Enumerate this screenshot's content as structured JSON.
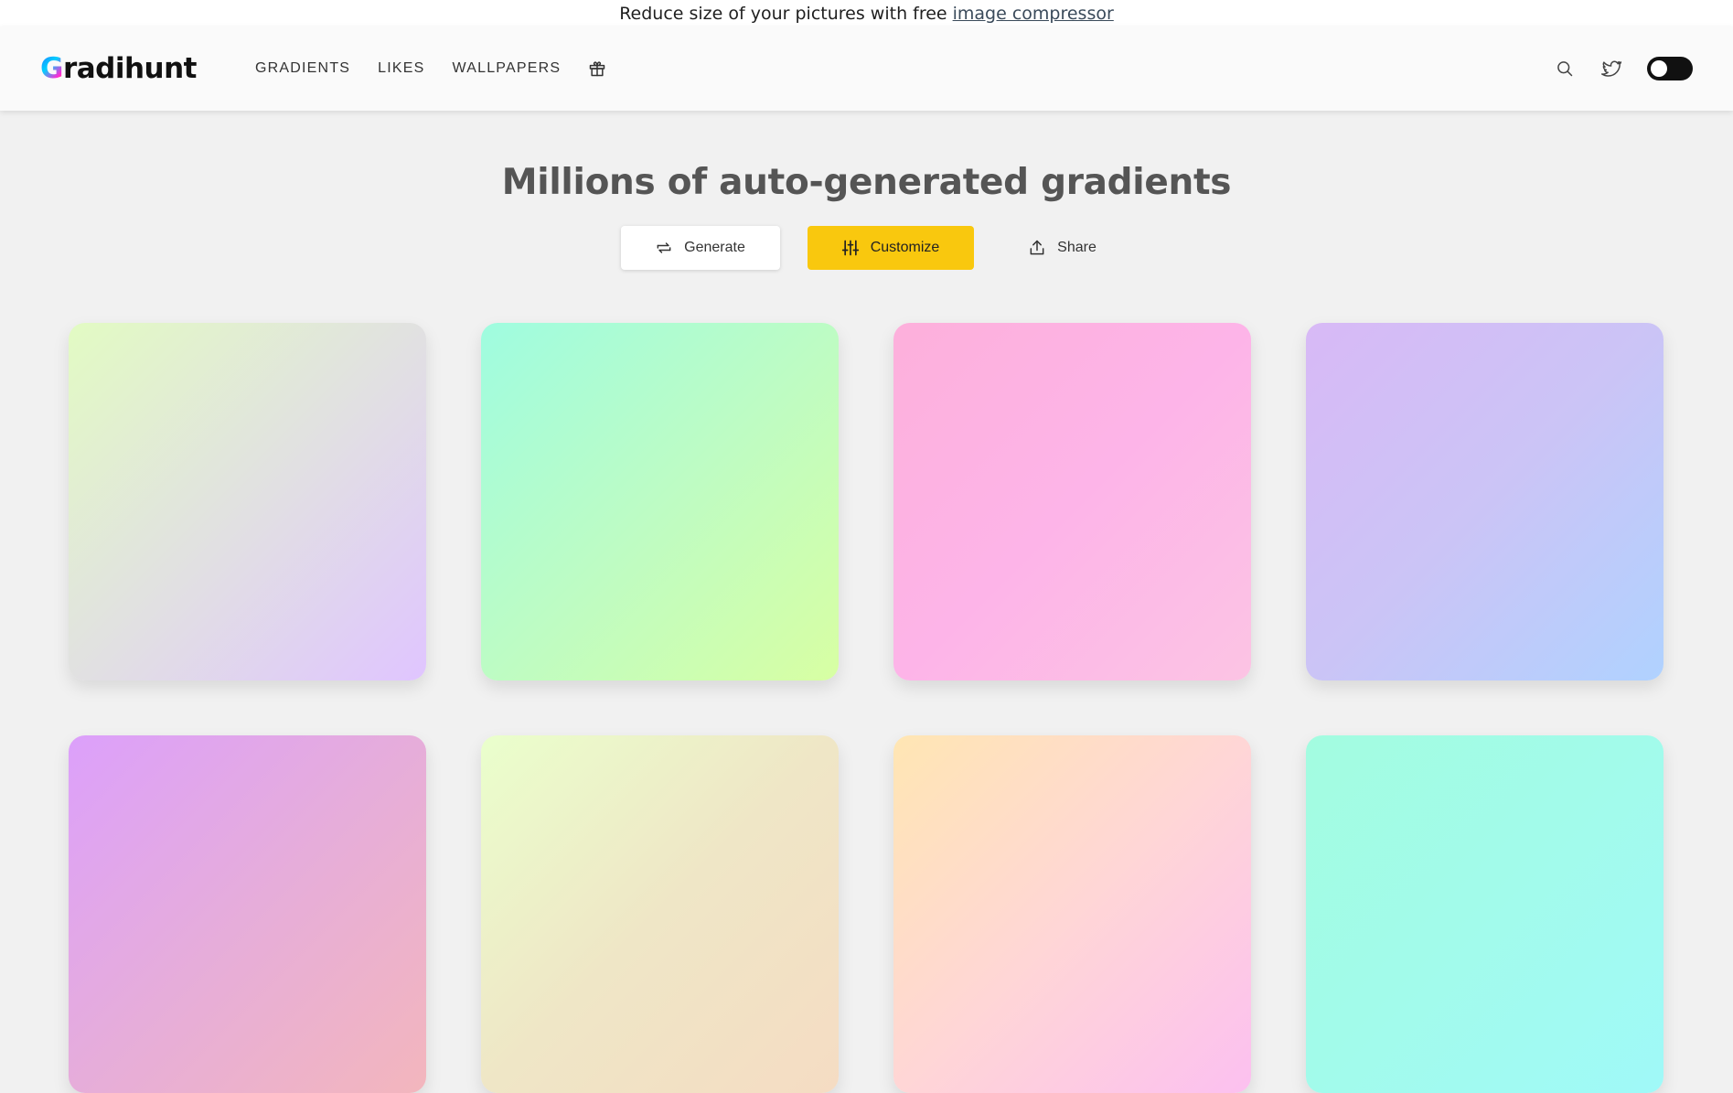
{
  "promo": {
    "text": "Reduce size of your pictures with free",
    "link_text": "image compressor"
  },
  "header": {
    "logo_first": "G",
    "logo_rest": "radihunt",
    "nav": [
      {
        "label": "GRADIENTS"
      },
      {
        "label": "LIKES"
      },
      {
        "label": "WALLPAPERS"
      }
    ],
    "icons": [
      "gift-icon",
      "search-icon",
      "twitter-icon",
      "theme-toggle"
    ]
  },
  "hero": {
    "title": "Millions of auto-generated gradients"
  },
  "actions": {
    "generate": "Generate",
    "customize": "Customize",
    "share": "Share"
  },
  "colors": {
    "accent": "#f9c80e",
    "background": "#f1f1f1"
  },
  "gradients": [
    {
      "from": "#e2fbc3",
      "mid": "#e1e1e1",
      "to": "#e0c5ff"
    },
    {
      "from": "#9ffce0",
      "mid": "#bdfcc4",
      "to": "#d8ffa3"
    },
    {
      "from": "#fdb0db",
      "mid": "#fdb4e8",
      "to": "#fcc4e4"
    },
    {
      "from": "#d8b9f6",
      "mid": "#cbc4f6",
      "to": "#b0d2ff"
    },
    {
      "from": "#dca0fb",
      "mid": "#e6adda",
      "to": "#f3b6bd"
    },
    {
      "from": "#eaffcc",
      "mid": "#efe6c6",
      "to": "#f5dcc3"
    },
    {
      "from": "#ffe6b3",
      "mid": "#ffd6d6",
      "to": "#fcc0f0"
    },
    {
      "from": "#a3fce0",
      "mid": "#a2fbeb",
      "to": "#a0f9f8"
    }
  ]
}
